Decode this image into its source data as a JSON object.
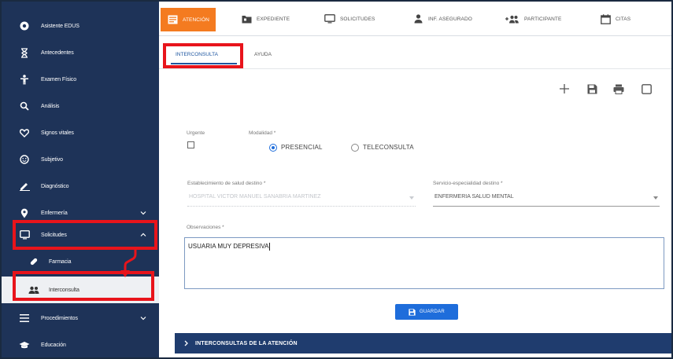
{
  "sidebar": {
    "items": [
      {
        "label": "Asistente EDUS",
        "icon": "help-circle-icon"
      },
      {
        "label": "Antecedentes",
        "icon": "hourglass-icon"
      },
      {
        "label": "Examen Físico",
        "icon": "person-icon"
      },
      {
        "label": "Análisis",
        "icon": "magnify-icon"
      },
      {
        "label": "Signos vitales",
        "icon": "heart-icon"
      },
      {
        "label": "Subjetivo",
        "icon": "face-icon"
      },
      {
        "label": "Diagnóstico",
        "icon": "pencil-icon"
      },
      {
        "label": "Enfermería",
        "icon": "location-pin-icon"
      },
      {
        "label": "Solicitudes",
        "icon": "monitor-icon"
      },
      {
        "label": "Farmacia",
        "icon": "pill-icon"
      },
      {
        "label": "Interconsulta",
        "icon": "people-icon"
      },
      {
        "label": "Procedimientos",
        "icon": "list-icon"
      },
      {
        "label": "Educación",
        "icon": "graduation-cap-icon"
      }
    ]
  },
  "topnav": {
    "tabs": [
      {
        "label": "ATENCIÓN",
        "icon": "clipboard-icon",
        "active": true
      },
      {
        "label": "EXPEDIENTE",
        "icon": "folder-icon"
      },
      {
        "label": "SOLICITUDES",
        "icon": "monitor-icon"
      },
      {
        "label": "INF. ASEGURADO",
        "icon": "person-icon"
      },
      {
        "label": "PARTICIPANTE",
        "icon": "add-people-icon"
      },
      {
        "label": "CITAS",
        "icon": "calendar-icon"
      }
    ]
  },
  "subtabs": [
    {
      "label": "INTERCONSULTA",
      "active": true
    },
    {
      "label": "AYUDA"
    }
  ],
  "toolbar": {
    "icons": [
      "add-icon",
      "save-icon",
      "print-icon",
      "window-icon"
    ]
  },
  "form": {
    "urgent_label": "Urgente",
    "modality_label": "Modalidad *",
    "modality_options": [
      "PRESENCIAL",
      "TELECONSULTA"
    ],
    "modality_selected": "PRESENCIAL",
    "establishment_label": "Establecimiento de salud destino *",
    "establishment_value": "HOSPITAL VICTOR MANUEL SANABRIA MARTINEZ",
    "service_label": "Servicio-especialidad destino *",
    "service_value": "ENFERMERIA SALUD MENTAL",
    "observations_label": "Observaciones *",
    "observations_value": "USUARIA MUY DEPRESIVA",
    "save_label": "GUARDAR"
  },
  "accordion": {
    "label": "INTERCONSULTAS DE LA ATENCIÓN"
  },
  "colors": {
    "sidebar_bg": "#1e3358",
    "active_tab": "#f47b20",
    "primary": "#1e6ddb",
    "highlight": "#e8141b",
    "accordion_bg": "#1f3c6e"
  }
}
